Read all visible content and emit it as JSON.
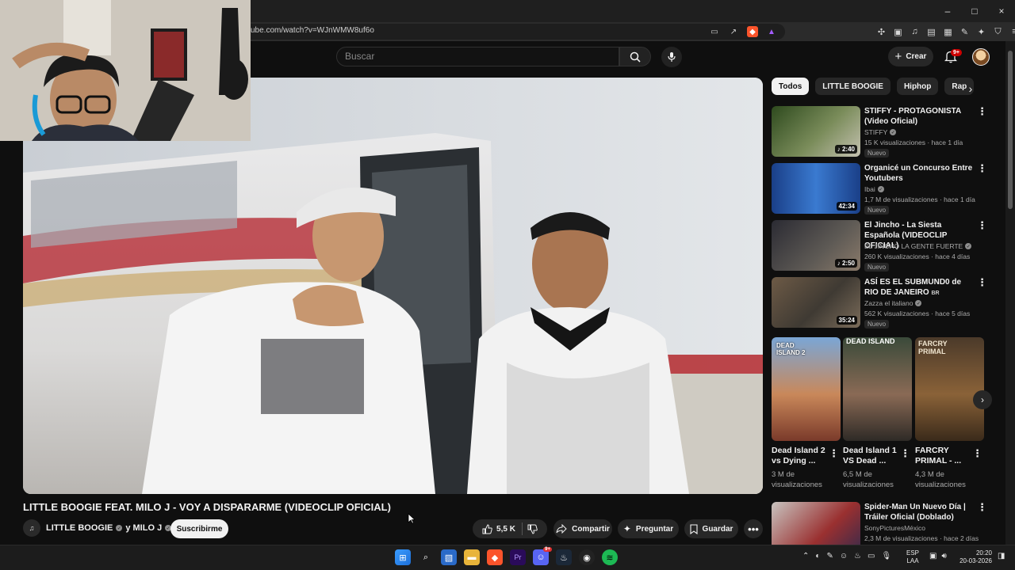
{
  "browser": {
    "url": "ube.com/watch?v=WJnWMW8uf6o",
    "window_controls": [
      "–",
      "□",
      "×"
    ]
  },
  "masthead": {
    "search_placeholder": "Buscar",
    "create_label": "Crear",
    "notifications_badge": "9+"
  },
  "video": {
    "title": "LITTLE BOOGIE FEAT. MILO J - VOY A DISPARARME (VIDEOCLIP OFICIAL)",
    "channel": "LITTLE BOOGIE",
    "channel_joiner": "y MILO J",
    "subscribe_label": "Suscribirme",
    "likes": "5,5 K",
    "share_label": "Compartir",
    "ask_label": "Preguntar",
    "save_label": "Guardar"
  },
  "chips": [
    "Todos",
    "LITTLE BOOGIE",
    "Hiphop",
    "Rap"
  ],
  "recommendations": [
    {
      "title": "STIFFY - PROTAGONISTA (Video Oficial)",
      "channel": "STIFFY",
      "meta": "15 K visualizaciones · hace 1 día",
      "duration": "2:40",
      "badge": "Nuevo",
      "thumb_color": "#3c5a2a"
    },
    {
      "title": "Organicé un Concurso Entre Youtubers",
      "channel": "Ibai",
      "meta": "1,7 M de visualizaciones · hace 1 día",
      "duration": "42:34",
      "badge": "Nuevo",
      "thumb_color": "#1e3c78"
    },
    {
      "title": "El Jincho - La Siesta Española (VIDEOCLIP OFICIAL)",
      "channel": "EL JINCHO LA GENTE FUERTE",
      "meta": "260 K visualizaciones · hace 4 días",
      "duration": "2:50",
      "badge": "Nuevo",
      "thumb_color": "#3a3a44"
    },
    {
      "title": "ASÍ ES EL SUBMUND0 de RIO DE JANEIRO",
      "title_suffix": "BR",
      "channel": "Zazza el italiano",
      "meta": "562 K visualizaciones · hace 5 días",
      "duration": "35:24",
      "badge": "Nuevo",
      "thumb_color": "#55493a"
    },
    {
      "title": "Spider-Man Un Nuevo Día | Tráiler Oficial (Doblado)",
      "channel": "SonyPicturesMéxico",
      "meta": "2,3 M de visualizaciones · hace 2 días",
      "thumb_color": "#5a2a2a"
    }
  ],
  "shelf": [
    {
      "title": "Dead Island 2 vs Dying ...",
      "views": "3 M de visualizaciones",
      "art_text": "DEAD ISLAND 2",
      "thumb_color": "#2f4f70"
    },
    {
      "title": "Dead Island 1 VS Dead ...",
      "views": "6,5 M de visualizaciones",
      "art_text": "DEAD ISLAND",
      "thumb_color": "#4a5a4a"
    },
    {
      "title": "FARCRY PRIMAL - ...",
      "views": "4,3 M de visualizaciones",
      "art_text": "FARCRY PRIMAL",
      "thumb_color": "#6b4a2f"
    }
  ],
  "taskbar": {
    "lang_top": "ESP",
    "lang_bottom": "LAA",
    "time": "20:20",
    "date": "20-03-2026",
    "discord_badge": "9+"
  }
}
